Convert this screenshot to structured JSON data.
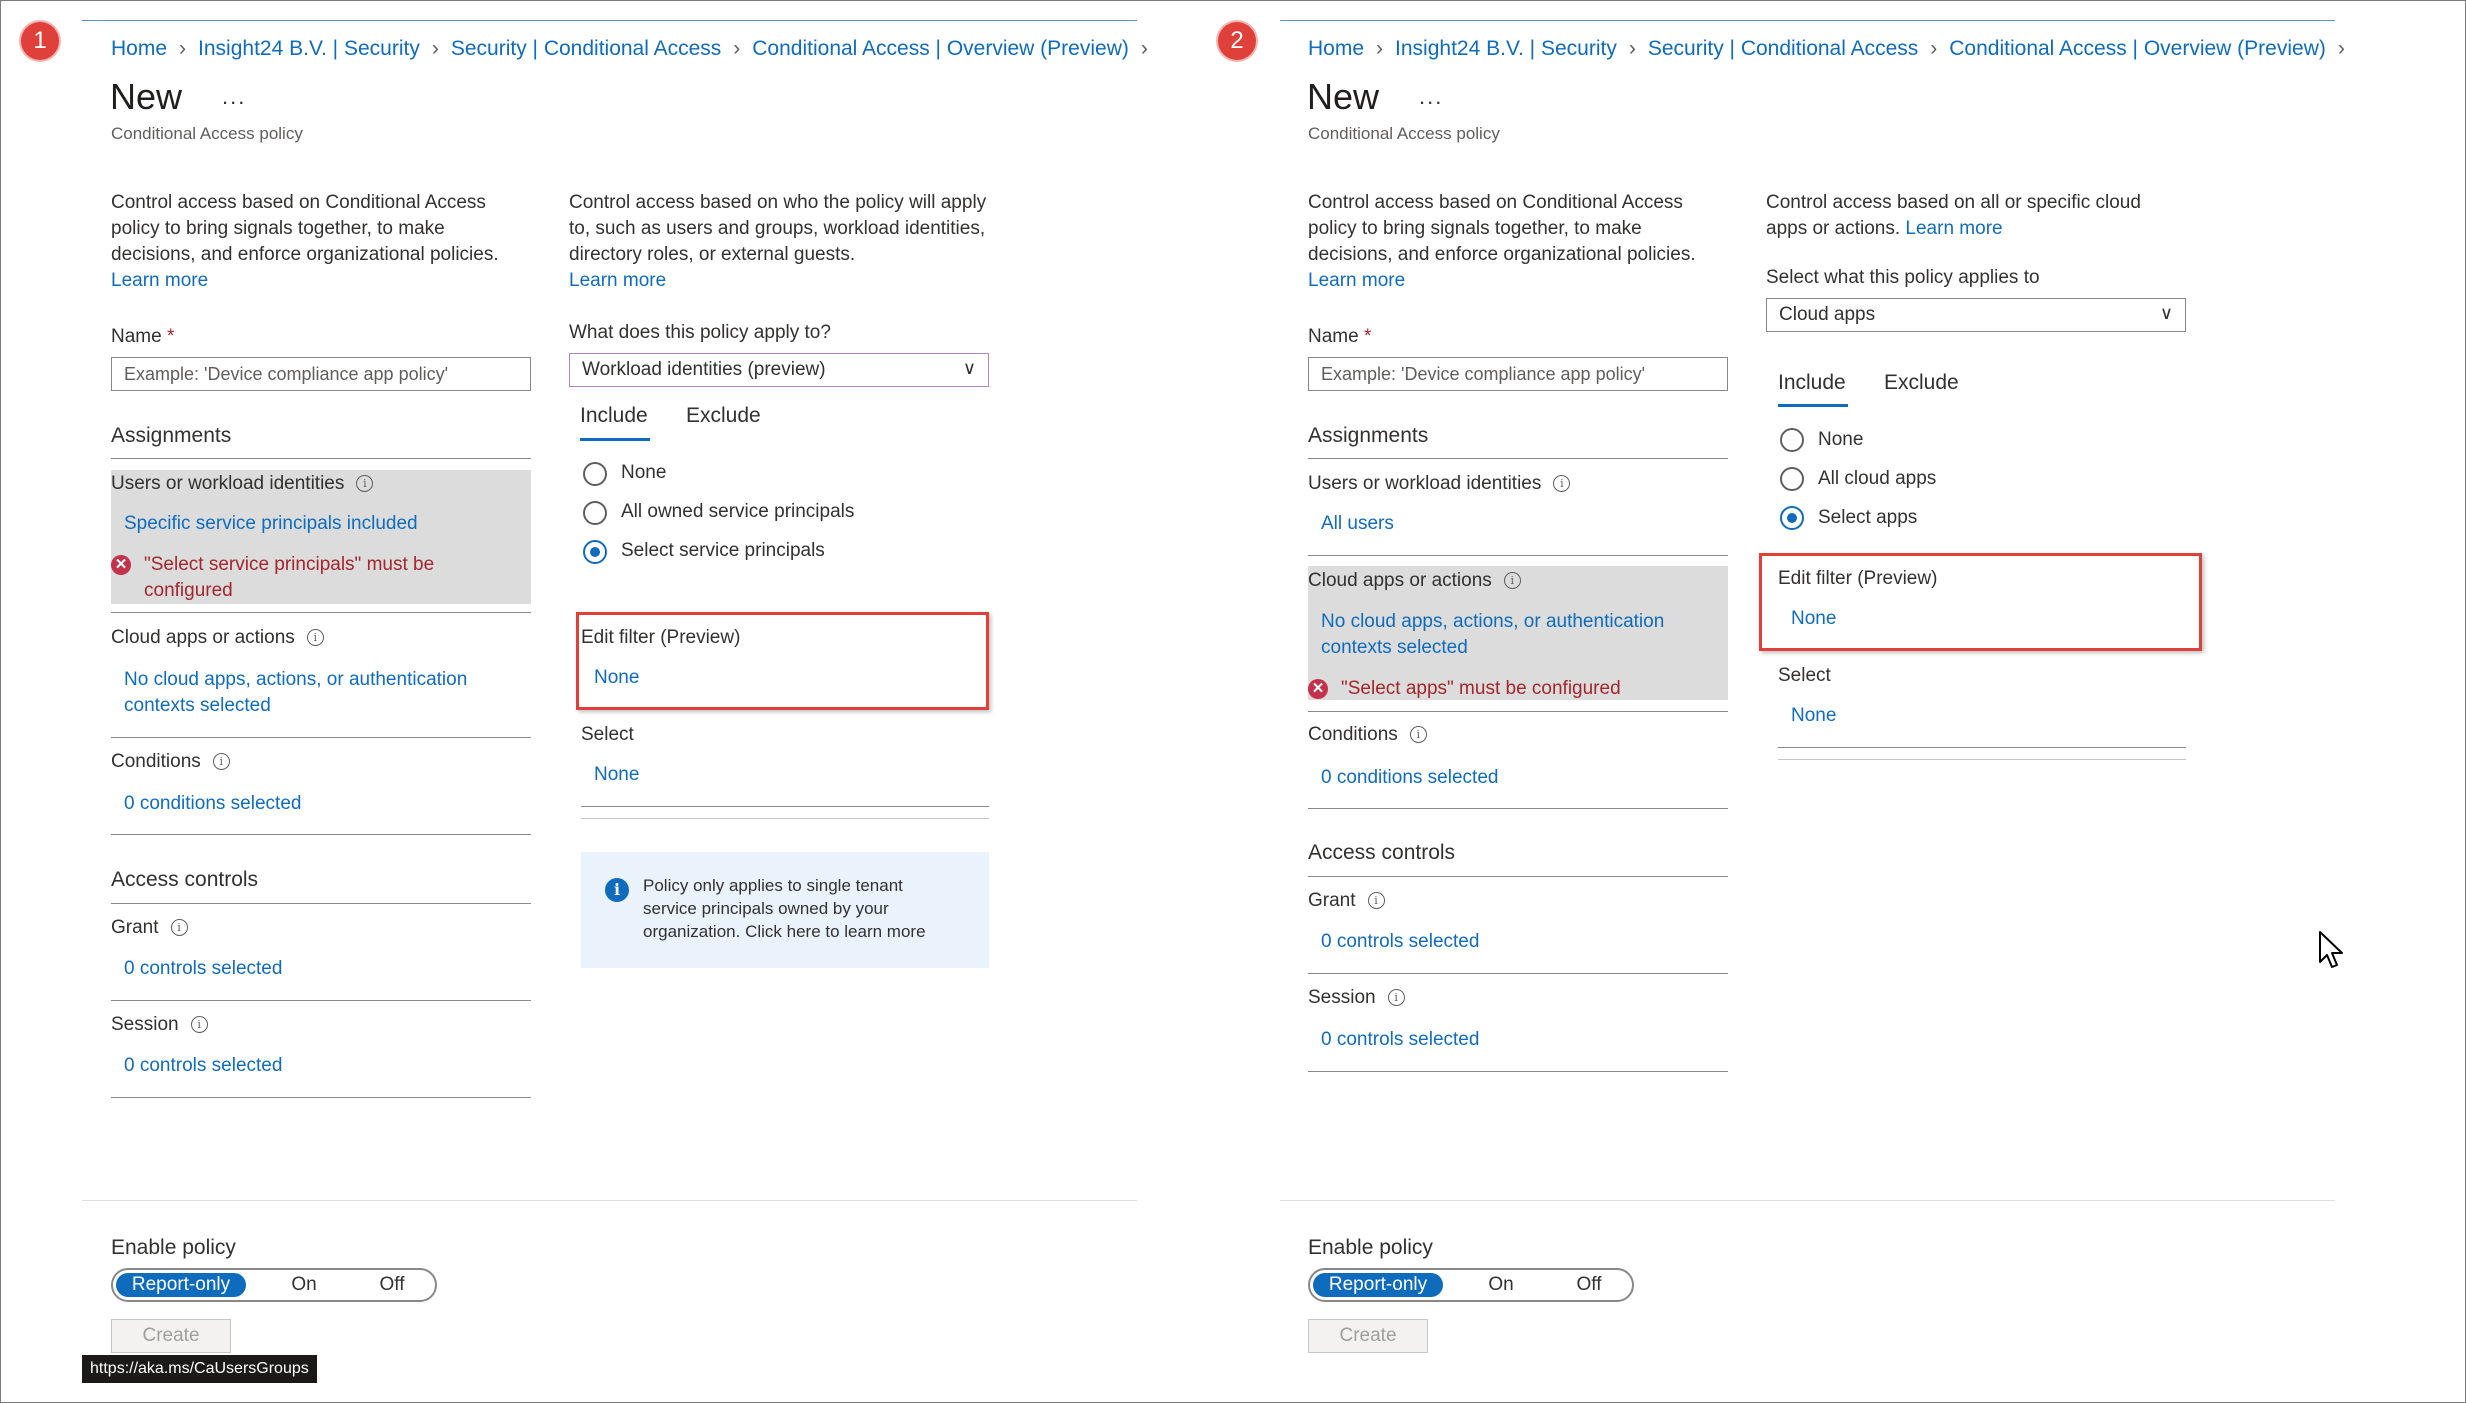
{
  "breadcrumb": [
    "Home",
    "Insight24 B.V. | Security",
    "Security | Conditional Access",
    "Conditional Access | Overview (Preview)"
  ],
  "page_title": "New",
  "page_subtitle": "Conditional Access policy",
  "more_label": "...",
  "intro_text": "Control access based on Conditional Access policy to bring signals together, to make decisions, and enforce organizational policies.",
  "learn_more": "Learn more",
  "name_label": "Name",
  "required_mark": "*",
  "name_placeholder": "Example: 'Device compliance app policy'",
  "assignments_heading": "Assignments",
  "access_controls_heading": "Access controls",
  "info_glyph": "i",
  "err_glyph": "✕",
  "panel1": {
    "step": "1",
    "users_label": "Users or workload identities",
    "users_value": "Specific service principals included",
    "users_error": "\"Select service principals\" must be configured",
    "cloud_label": "Cloud apps or actions",
    "cloud_value": "No cloud apps, actions, or authentication contexts selected",
    "conditions_label": "Conditions",
    "conditions_value": "0 conditions selected",
    "grant_label": "Grant",
    "grant_value": "0 controls selected",
    "session_label": "Session",
    "session_value": "0 controls selected",
    "right_desc": "Control access based on who the policy will apply to, such as users and groups, workload identities, directory roles, or external guests.",
    "apply_question": "What does this policy apply to?",
    "apply_value": "Workload identities (preview)",
    "tab_include": "Include",
    "tab_exclude": "Exclude",
    "radios": [
      "None",
      "All owned service principals",
      "Select service principals"
    ],
    "radio_selected": 2,
    "edit_filter_label": "Edit filter (Preview)",
    "edit_filter_value": "None",
    "select_label": "Select",
    "select_value": "None",
    "info_text": "Policy only applies to single tenant service principals owned by your organization. Click here to learn more"
  },
  "panel2": {
    "step": "2",
    "users_label": "Users or workload identities",
    "users_value": "All users",
    "cloud_label": "Cloud apps or actions",
    "cloud_value": "No cloud apps, actions, or authentication contexts selected",
    "cloud_error": "\"Select apps\" must be configured",
    "conditions_label": "Conditions",
    "conditions_value": "0 conditions selected",
    "grant_label": "Grant",
    "grant_value": "0 controls selected",
    "session_label": "Session",
    "session_value": "0 controls selected",
    "right_desc": "Control access based on all or specific cloud apps or actions.",
    "applies_label": "Select what this policy applies to",
    "applies_value": "Cloud apps",
    "tab_include": "Include",
    "tab_exclude": "Exclude",
    "radios": [
      "None",
      "All cloud apps",
      "Select apps"
    ],
    "radio_selected": 2,
    "edit_filter_label": "Edit filter (Preview)",
    "edit_filter_value": "None",
    "select_label": "Select",
    "select_value": "None"
  },
  "enable_policy": {
    "label": "Enable policy",
    "options": [
      "Report-only",
      "On",
      "Off"
    ],
    "selected": "Report-only",
    "create": "Create"
  },
  "status_url": "https://aka.ms/CaUsersGroups",
  "colors": {
    "link": "#0f6cbd",
    "error": "#a4262c",
    "highlight_box": "#e0403a",
    "step_badge": "#e0403a"
  }
}
